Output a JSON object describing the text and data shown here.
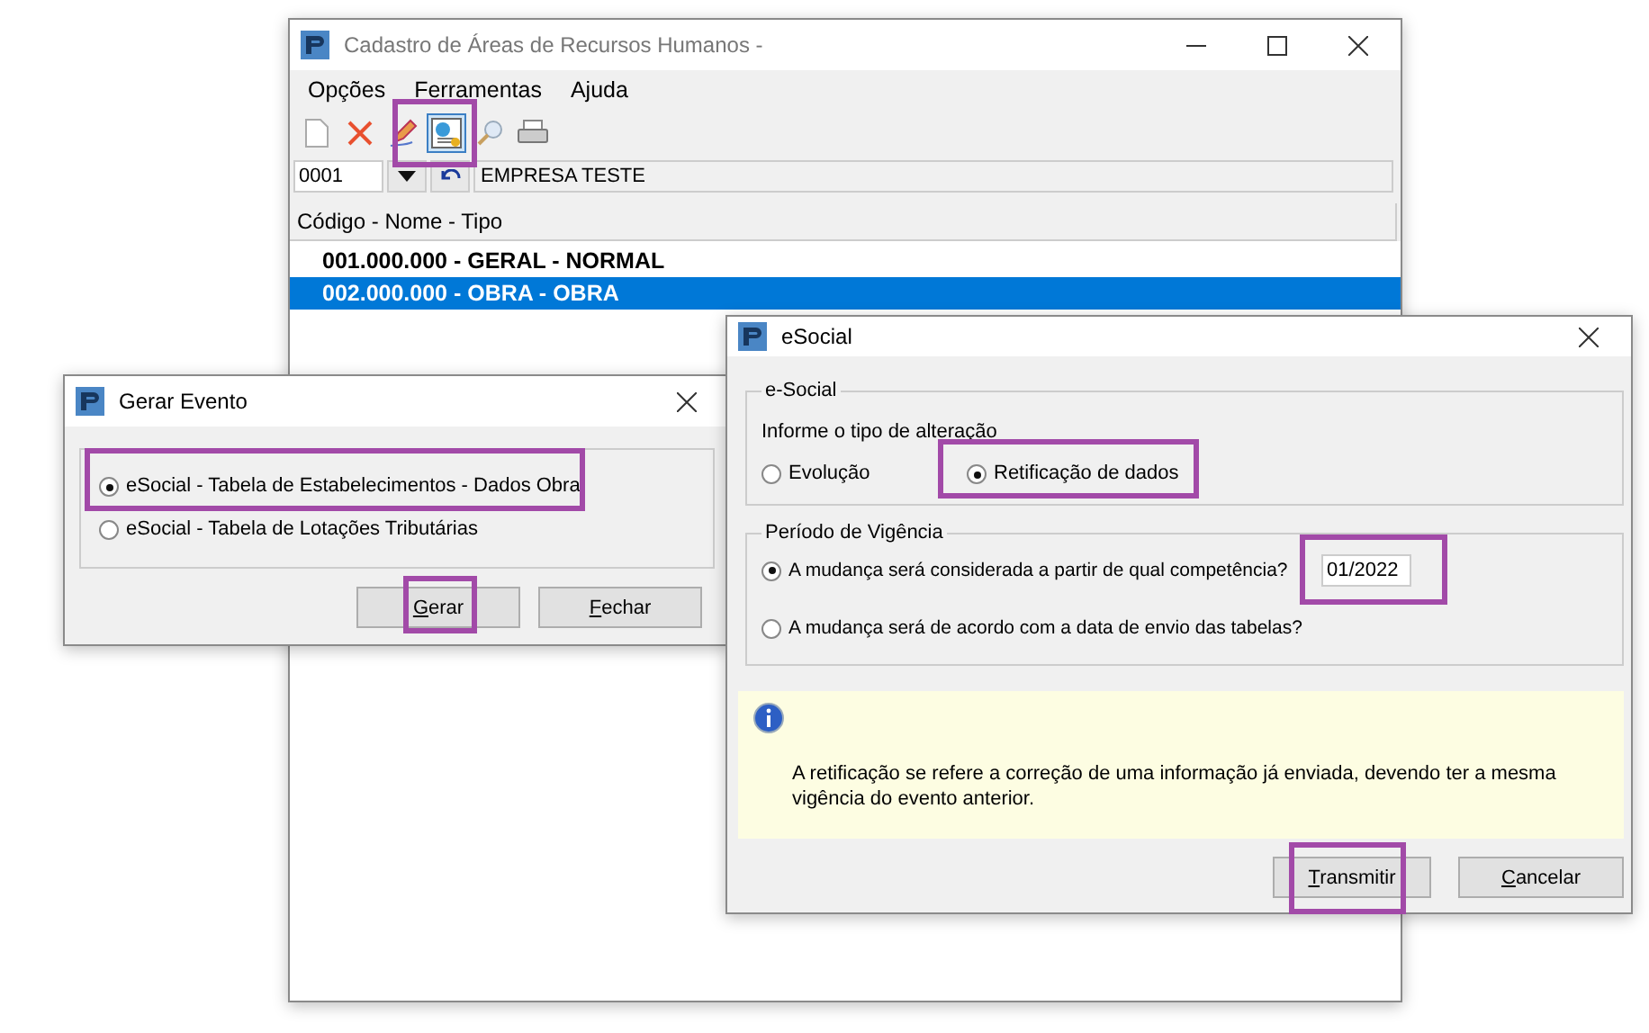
{
  "main_window": {
    "title": "Cadastro de Áreas de Recursos Humanos -",
    "menu": [
      "Opções",
      "Ferramentas",
      "Ajuda"
    ],
    "toolbar": [
      {
        "kind": "new",
        "pressed": false
      },
      {
        "kind": "delete",
        "pressed": false
      },
      {
        "kind": "edit",
        "pressed": false
      },
      {
        "kind": "event",
        "pressed": true
      },
      {
        "kind": "search",
        "pressed": false
      },
      {
        "kind": "print",
        "pressed": false
      }
    ],
    "company": {
      "code": "0001",
      "name": "EMPRESA TESTE"
    },
    "list": {
      "header": "Código - Nome - Tipo",
      "rows": [
        {
          "text": "001.000.000 - GERAL - NORMAL",
          "selected": false
        },
        {
          "text": "002.000.000 - OBRA - OBRA",
          "selected": true
        }
      ]
    }
  },
  "gerar_dialog": {
    "title": "Gerar Evento",
    "options": [
      {
        "label": "eSocial - Tabela de Estabelecimentos - Dados Obra",
        "selected": true
      },
      {
        "label": "eSocial - Tabela de Lotações Tributárias",
        "selected": false
      }
    ],
    "buttons": [
      "Gerar",
      "Fechar"
    ]
  },
  "esocial_dialog": {
    "title": "eSocial",
    "type_group": {
      "title": "e-Social",
      "prompt": "Informe o tipo de alteração",
      "options": [
        {
          "label": "Evolução",
          "selected": false
        },
        {
          "label": "Retificação de dados",
          "selected": true
        }
      ]
    },
    "period_group": {
      "title": "Período de Vigência",
      "options": [
        {
          "label": "A mudança será considerada a partir de qual competência?",
          "selected": true,
          "value": "01/2022"
        },
        {
          "label": "A mudança será de acordo com a data de envio das tabelas?",
          "selected": false
        }
      ]
    },
    "info": "A retificação se refere a correção de uma informação já enviada, devendo ter a mesma vigência do evento anterior.",
    "buttons": [
      "Transmitir",
      "Cancelar"
    ]
  }
}
